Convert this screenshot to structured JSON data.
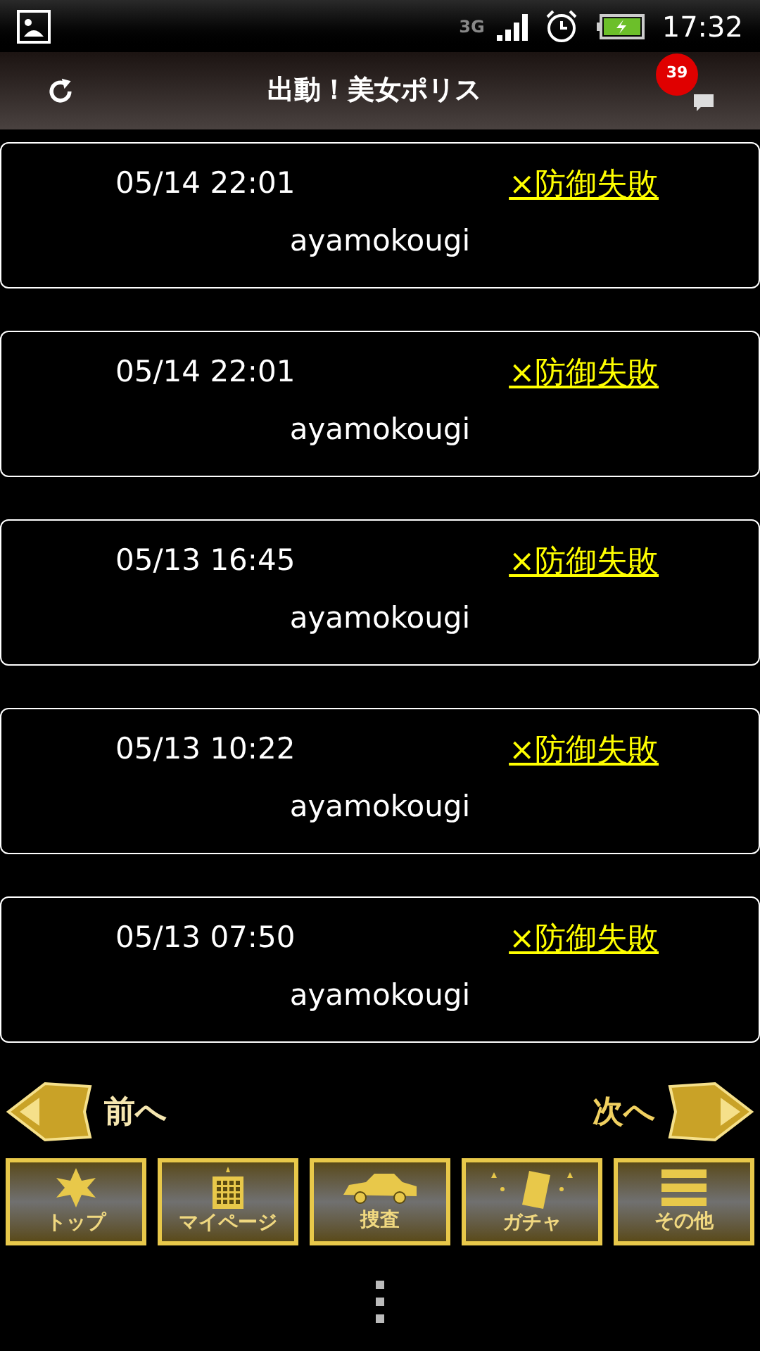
{
  "status_bar": {
    "network": "3G",
    "time": "17:32"
  },
  "header": {
    "title": "出動！美女ポリス",
    "notification_count": "39"
  },
  "records": [
    {
      "time": "05/14 22:01",
      "result": "×防御失敗",
      "name": "ayamokougi"
    },
    {
      "time": "05/14 22:01",
      "result": "×防御失敗",
      "name": "ayamokougi"
    },
    {
      "time": "05/13 16:45",
      "result": "×防御失敗",
      "name": "ayamokougi"
    },
    {
      "time": "05/13 10:22",
      "result": "×防御失敗",
      "name": "ayamokougi"
    },
    {
      "time": "05/13 07:50",
      "result": "×防御失敗",
      "name": "ayamokougi"
    }
  ],
  "pager": {
    "prev": "前へ",
    "next": "次へ"
  },
  "nav": [
    {
      "kind": "badge",
      "label": "トップ"
    },
    {
      "kind": "building",
      "label": "マイページ"
    },
    {
      "kind": "car",
      "label": "捜査"
    },
    {
      "kind": "card",
      "label": "ガチャ"
    },
    {
      "kind": "menu",
      "label": "その他"
    }
  ]
}
